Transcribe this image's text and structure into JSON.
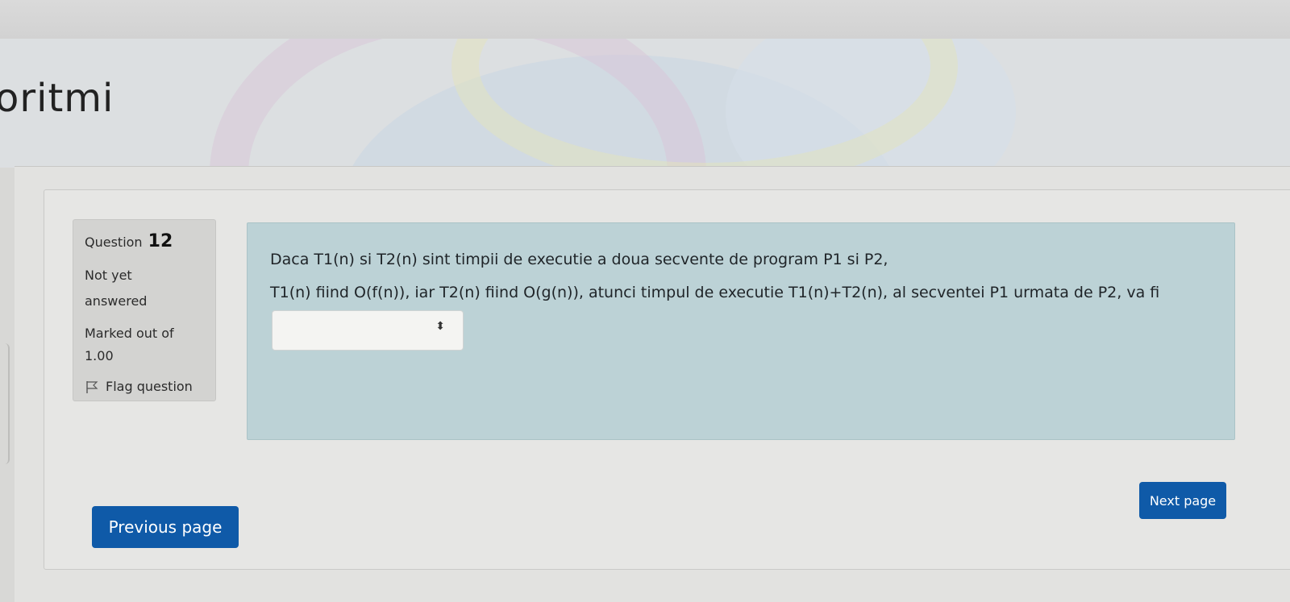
{
  "header": {
    "course_title": "oritmi"
  },
  "question_info": {
    "label": "Question",
    "number": "12",
    "state_line1": "Not yet",
    "state_line2": "answered",
    "grade_line1": "Marked out of",
    "grade_line2": "1.00",
    "flag_label": "Flag question"
  },
  "question": {
    "text_line1": "Daca T1(n) si T2(n) sint timpii de executie a doua secvente de program P1 si P2,",
    "text_line2": "T1(n) fiind O(f(n)), iar T2(n) fiind O(g(n)), atunci timpul de executie T1(n)+T2(n), al secventei P1 urmata de P2, va fi",
    "answer_select": {
      "selected_value": "",
      "caret_glyph": "⬍"
    }
  },
  "navigation": {
    "previous_label": "Previous page",
    "next_label": "Next page"
  },
  "colors": {
    "button": "#0f5aa8",
    "question_bg": "#bcd2d6",
    "info_bg": "#d3d3d1"
  }
}
